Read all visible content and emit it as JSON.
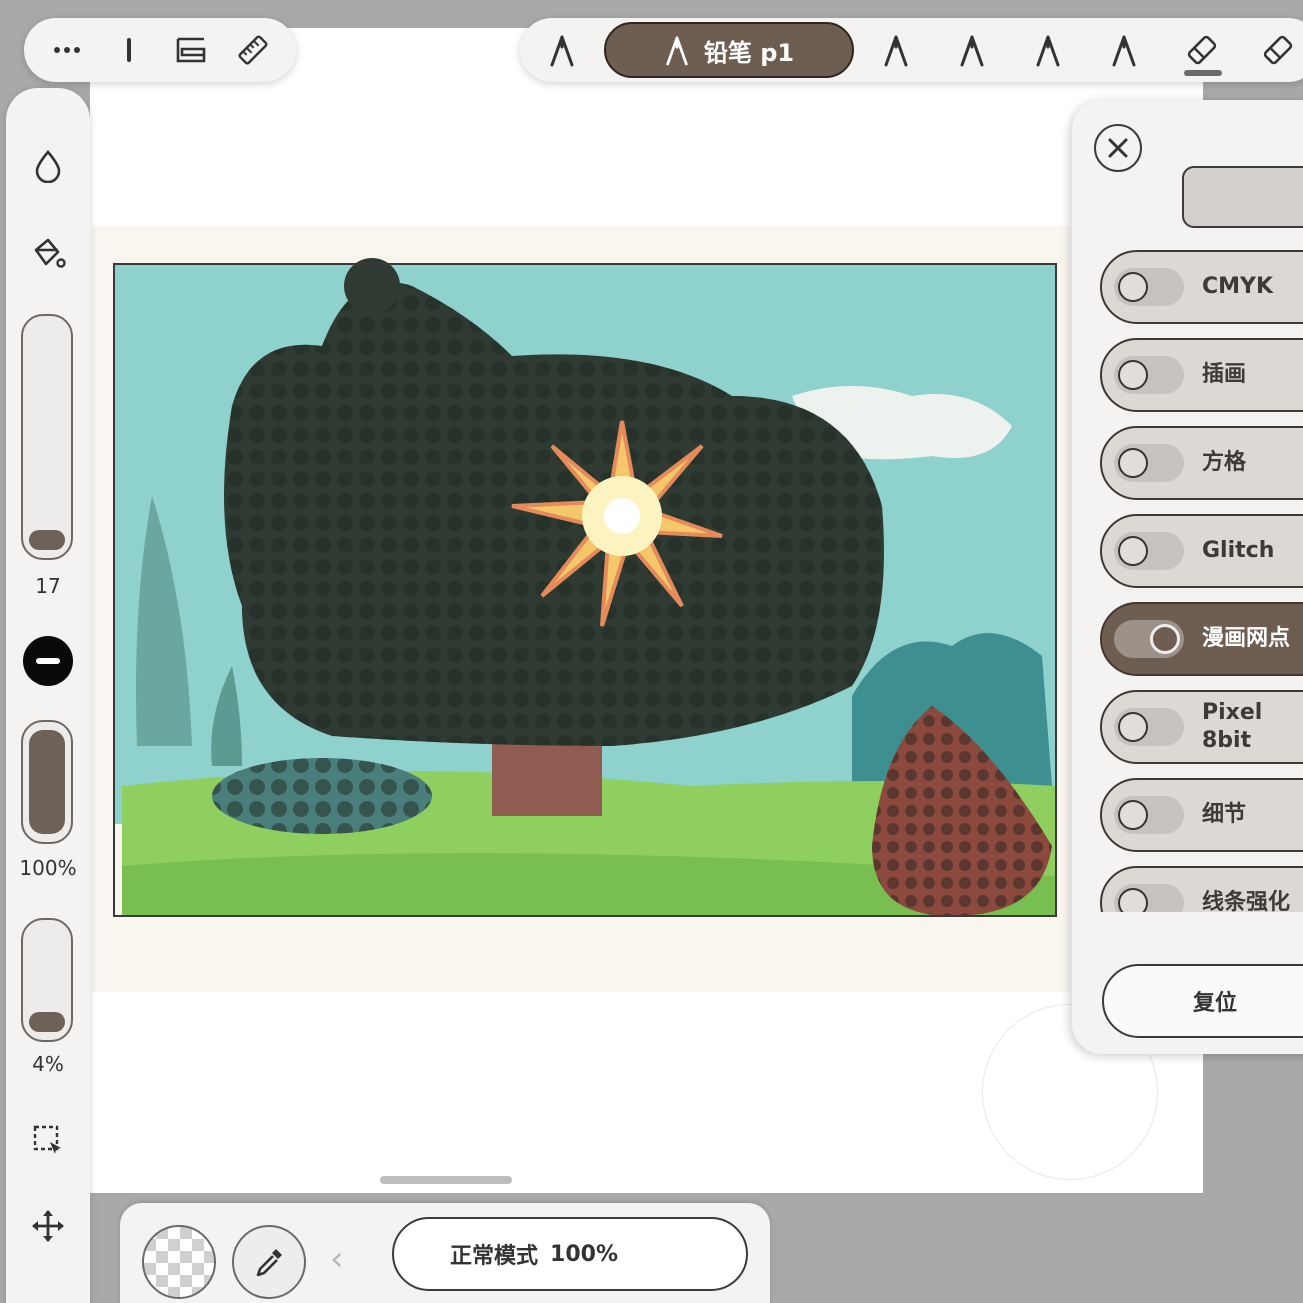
{
  "toolbar": {
    "tools": [
      "more-icon",
      "line-icon",
      "layers-icon",
      "ruler-icon"
    ],
    "brushes": {
      "active_label": "铅笔 p1"
    }
  },
  "sidebar": {
    "size_value": "17",
    "size_fraction": 0.08,
    "opacity_value": "100%",
    "opacity_fraction": 1.0,
    "smoothing_value": "4%",
    "smoothing_fraction": 0.04
  },
  "filter_panel": {
    "options": [
      {
        "label": "CMYK",
        "on": false
      },
      {
        "label": "插画",
        "on": false
      },
      {
        "label": "方格",
        "on": false
      },
      {
        "label": "Glitch",
        "on": false
      },
      {
        "label": "漫画网点",
        "on": true
      },
      {
        "label": "Pixel\n8bit",
        "on": false
      },
      {
        "label": "细节",
        "on": false
      },
      {
        "label": "线条强化",
        "on": false
      }
    ],
    "reset_label": "复位"
  },
  "bottom_bar": {
    "blend_mode": "正常模式",
    "opacity": "100%"
  },
  "colors": {
    "accent": "#6e5e51",
    "panel_bg": "#f4f3f1",
    "desk_bg": "#a9a9a9"
  }
}
